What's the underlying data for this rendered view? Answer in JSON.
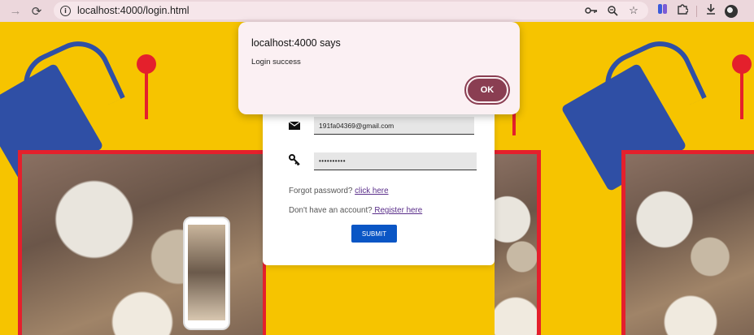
{
  "browser": {
    "url": "localhost:4000/login.html"
  },
  "dialog": {
    "title": "localhost:4000 says",
    "message": "Login success",
    "ok_label": "OK"
  },
  "login": {
    "email_value": "191fa04369@gmail.com",
    "password_value": "••••••••••",
    "forgot_text": "Forgot password? ",
    "forgot_link": "click here",
    "register_text": "Don't have an account?",
    "register_link": " Register here",
    "submit_label": "SUBMIT"
  },
  "colors": {
    "background": "#f6c400",
    "accent_red": "#e4202c",
    "bag_blue": "#2f4fa5",
    "submit_blue": "#0a56c5",
    "ok_button": "#8a3e52"
  }
}
